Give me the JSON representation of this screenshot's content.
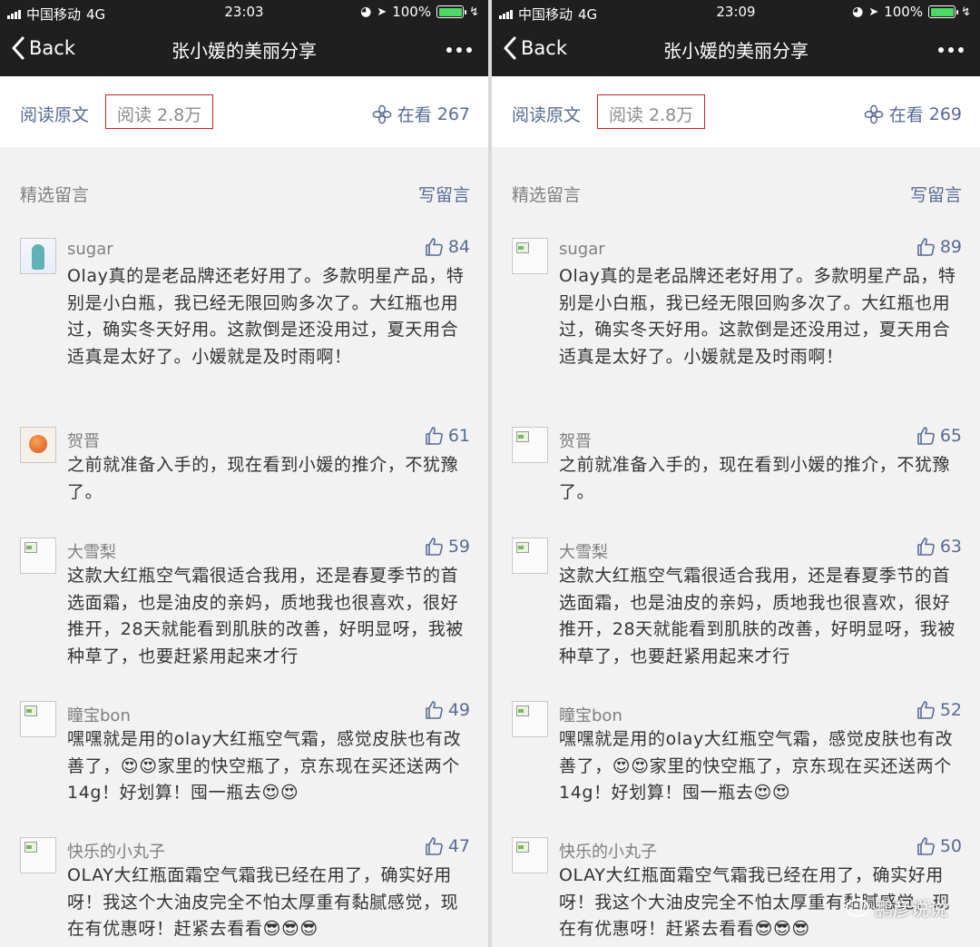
{
  "screens": [
    {
      "status": {
        "carrier": "中国移动",
        "network": "4G",
        "time": "23:03",
        "battery": "100%",
        "battery_level": 1.0
      },
      "nav": {
        "back_label": "Back",
        "title": "张小媛的美丽分享"
      },
      "read_bar": {
        "read_original": "阅读原文",
        "read_count": "阅读 2.8万",
        "zaikan_label": "在看",
        "zaikan_count": "267"
      },
      "section": {
        "title": "精选留言",
        "write": "写留言"
      },
      "comments": [
        {
          "name": "sugar",
          "likes": "84",
          "avatar": "img-a",
          "text": "Olay真的是老品牌还老好用了。多款明星产品，特别是小白瓶，我已经无限回购多次了。大红瓶也用过，确实冬天好用。这款倒是还没用过，夏天用合适真是太好了。小媛就是及时雨啊！"
        },
        {
          "name": "贺晋",
          "likes": "61",
          "avatar": "img-b",
          "text": "之前就准备入手的，现在看到小媛的推介，不犹豫了。"
        },
        {
          "name": "大雪梨",
          "likes": "59",
          "avatar": "broken",
          "text": "这款大红瓶空气霜很适合我用，还是春夏季节的首选面霜，也是油皮的亲妈，质地我也很喜欢，很好推开，28天就能看到肌肤的改善，好明显呀，我被种草了，也要赶紧用起来才行"
        },
        {
          "name": "瞳宝bon",
          "likes": "49",
          "avatar": "broken",
          "text": "嘿嘿就是用的olay大红瓶空气霜，感觉皮肤也有改善了，😍😍家里的快空瓶了，京东现在买还送两个14g！好划算！囤一瓶去😍😍"
        },
        {
          "name": "快乐的小丸子",
          "likes": "47",
          "avatar": "broken",
          "text": "OLAY大红瓶面霜空气霜我已经在用了，确实好用呀！我这个大油皮完全不怕太厚重有黏腻感觉，现在有优惠呀！赶紧去看看😎😎😎"
        }
      ]
    },
    {
      "status": {
        "carrier": "中国移动",
        "network": "4G",
        "time": "23:09",
        "battery": "100%",
        "battery_level": 1.0
      },
      "nav": {
        "back_label": "Back",
        "title": "张小媛的美丽分享"
      },
      "read_bar": {
        "read_original": "阅读原文",
        "read_count": "阅读 2.8万",
        "zaikan_label": "在看",
        "zaikan_count": "269"
      },
      "section": {
        "title": "精选留言",
        "write": "写留言"
      },
      "comments": [
        {
          "name": "sugar",
          "likes": "89",
          "avatar": "broken",
          "text": "Olay真的是老品牌还老好用了。多款明星产品，特别是小白瓶，我已经无限回购多次了。大红瓶也用过，确实冬天好用。这款倒是还没用过，夏天用合适真是太好了。小媛就是及时雨啊！"
        },
        {
          "name": "贺晋",
          "likes": "65",
          "avatar": "broken",
          "text": "之前就准备入手的，现在看到小媛的推介，不犹豫了。"
        },
        {
          "name": "大雪梨",
          "likes": "63",
          "avatar": "broken",
          "text": "这款大红瓶空气霜很适合我用，还是春夏季节的首选面霜，也是油皮的亲妈，质地我也很喜欢，很好推开，28天就能看到肌肤的改善，好明显呀，我被种草了，也要赶紧用起来才行"
        },
        {
          "name": "瞳宝bon",
          "likes": "52",
          "avatar": "broken",
          "text": "嘿嘿就是用的olay大红瓶空气霜，感觉皮肤也有改善了，😍😍家里的快空瓶了，京东现在买还送两个14g！好划算！囤一瓶去😍😍"
        },
        {
          "name": "快乐的小丸子",
          "likes": "50",
          "avatar": "broken",
          "text": "OLAY大红瓶面霜空气霜我已经在用了，确实好用呀！我这个大油皮完全不怕太厚重有黏腻感觉，现在有优惠呀！赶紧去看看😎😎😎"
        }
      ]
    }
  ],
  "watermark": {
    "text": "鹏彦说说"
  },
  "colors": {
    "link": "#576b95",
    "highlight_border": "#c2262a",
    "bar_bg": "#1f1f1f"
  }
}
